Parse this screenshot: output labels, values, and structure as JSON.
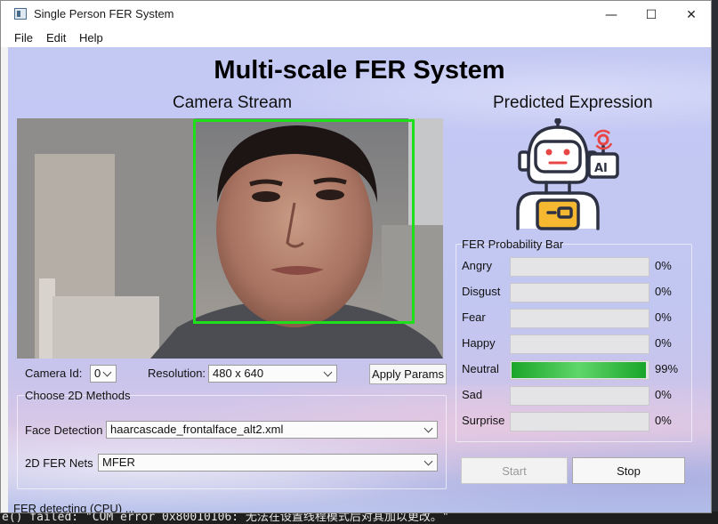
{
  "window": {
    "title": "Single Person FER System",
    "minimize": "—",
    "maximize": "☐",
    "close": "✕"
  },
  "menu": [
    "File",
    "Edit",
    "Help"
  ],
  "main_title": "Multi-scale FER System",
  "camera_section": {
    "title": "Camera Stream"
  },
  "prediction_section": {
    "title": "Predicted Expression"
  },
  "controls": {
    "camera_id_label": "Camera Id:",
    "camera_id_value": "0",
    "resolution_label": "Resolution:",
    "resolution_value": "480 x 640",
    "apply_button": "Apply Params",
    "methods_title": "Choose 2D Methods",
    "face_detection_label": "Face Detection",
    "face_detection_value": "haarcascade_frontalface_alt2.xml",
    "fer_nets_label": "2D FER Nets",
    "fer_nets_value": "MFER"
  },
  "probability": {
    "title": "FER Probability Bar",
    "rows": [
      {
        "label": "Angry",
        "value": 0,
        "text": "0%"
      },
      {
        "label": "Disgust",
        "value": 0,
        "text": "0%"
      },
      {
        "label": "Fear",
        "value": 0,
        "text": "0%"
      },
      {
        "label": "Happy",
        "value": 0,
        "text": "0%"
      },
      {
        "label": "Neutral",
        "value": 0.99,
        "text": "99%"
      },
      {
        "label": "Sad",
        "value": 0,
        "text": "0%"
      },
      {
        "label": "Surprise",
        "value": 0,
        "text": "0%"
      }
    ]
  },
  "buttons": {
    "start": "Start",
    "stop": "Stop"
  },
  "status": "FER detecting (CPU) ...",
  "terminal_text": "e() failed: \"COM error 0x80010106: 无法在设置线程模式后对其加以更改。\"",
  "colors": {
    "bar_fill": "#1aa52a",
    "face_box": "#1ee01a",
    "robot_line": "#2d3142",
    "robot_accent": "#e84545",
    "robot_yellow": "#f6b830"
  }
}
